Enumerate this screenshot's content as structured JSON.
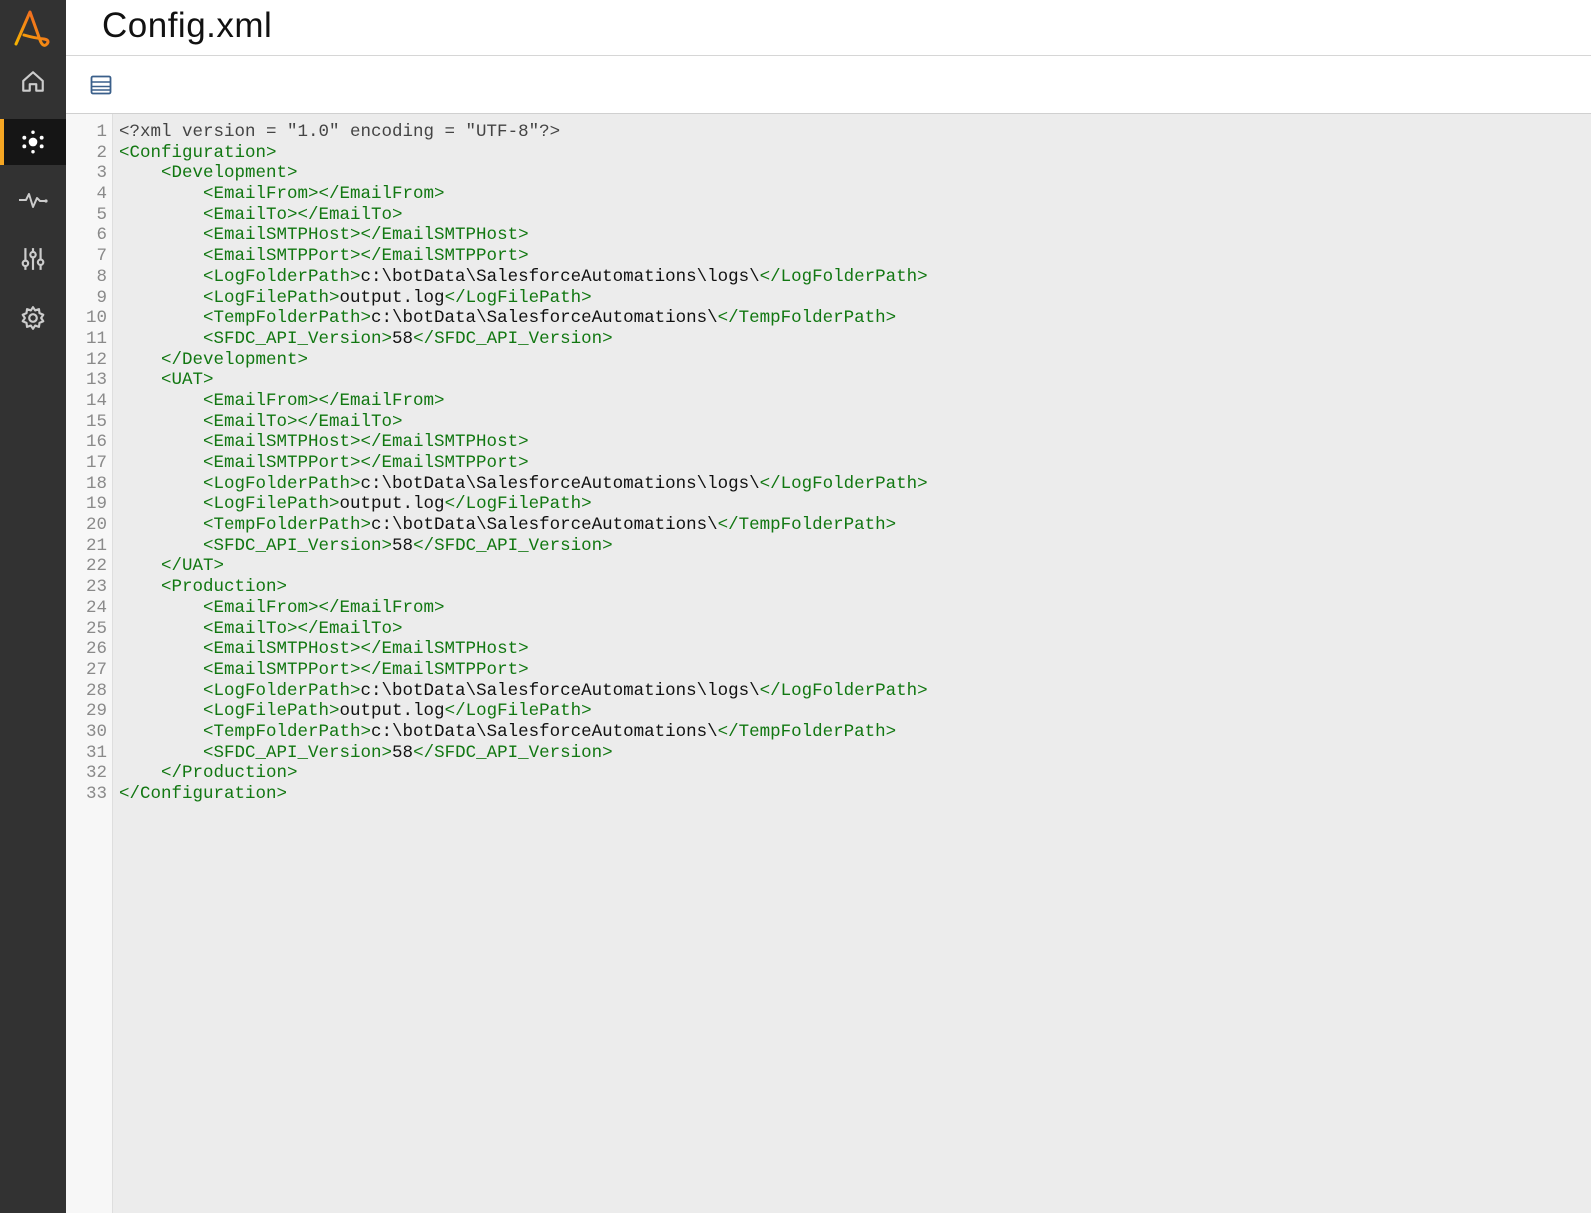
{
  "header": {
    "title": "Config.xml"
  },
  "sidebar": {
    "items": [
      {
        "name": "home",
        "icon": "home-icon"
      },
      {
        "name": "bots",
        "icon": "bot-cluster-icon",
        "active": true
      },
      {
        "name": "activity",
        "icon": "pulse-icon"
      },
      {
        "name": "controls",
        "icon": "sliders-icon"
      },
      {
        "name": "settings",
        "icon": "gear-icon"
      }
    ]
  },
  "colors": {
    "accent": "#f5a623",
    "tag": "#117711",
    "sidebar": "#323232"
  },
  "editor": {
    "lines": [
      [
        [
          "decl",
          "<?xml version = \"1.0\" encoding = \"UTF-8\"?>"
        ]
      ],
      [
        [
          "tag",
          "<Configuration>"
        ]
      ],
      [
        [
          "txt",
          "    "
        ],
        [
          "tag",
          "<Development>"
        ]
      ],
      [
        [
          "txt",
          "        "
        ],
        [
          "tag",
          "<EmailFrom></EmailFrom>"
        ]
      ],
      [
        [
          "txt",
          "        "
        ],
        [
          "tag",
          "<EmailTo></EmailTo>"
        ]
      ],
      [
        [
          "txt",
          "        "
        ],
        [
          "tag",
          "<EmailSMTPHost></EmailSMTPHost>"
        ]
      ],
      [
        [
          "txt",
          "        "
        ],
        [
          "tag",
          "<EmailSMTPPort></EmailSMTPPort>"
        ]
      ],
      [
        [
          "txt",
          "        "
        ],
        [
          "tag",
          "<LogFolderPath>"
        ],
        [
          "txt",
          "c:\\botData\\SalesforceAutomations\\logs\\"
        ],
        [
          "tag",
          "</LogFolderPath>"
        ]
      ],
      [
        [
          "txt",
          "        "
        ],
        [
          "tag",
          "<LogFilePath>"
        ],
        [
          "txt",
          "output.log"
        ],
        [
          "tag",
          "</LogFilePath>"
        ]
      ],
      [
        [
          "txt",
          "        "
        ],
        [
          "tag",
          "<TempFolderPath>"
        ],
        [
          "txt",
          "c:\\botData\\SalesforceAutomations\\"
        ],
        [
          "tag",
          "</TempFolderPath>"
        ]
      ],
      [
        [
          "txt",
          "        "
        ],
        [
          "tag",
          "<SFDC_API_Version>"
        ],
        [
          "txt",
          "58"
        ],
        [
          "tag",
          "</SFDC_API_Version>"
        ]
      ],
      [
        [
          "txt",
          "    "
        ],
        [
          "tag",
          "</Development>"
        ]
      ],
      [
        [
          "txt",
          "    "
        ],
        [
          "tag",
          "<UAT>"
        ]
      ],
      [
        [
          "txt",
          "        "
        ],
        [
          "tag",
          "<EmailFrom></EmailFrom>"
        ]
      ],
      [
        [
          "txt",
          "        "
        ],
        [
          "tag",
          "<EmailTo></EmailTo>"
        ]
      ],
      [
        [
          "txt",
          "        "
        ],
        [
          "tag",
          "<EmailSMTPHost></EmailSMTPHost>"
        ]
      ],
      [
        [
          "txt",
          "        "
        ],
        [
          "tag",
          "<EmailSMTPPort></EmailSMTPPort>"
        ]
      ],
      [
        [
          "txt",
          "        "
        ],
        [
          "tag",
          "<LogFolderPath>"
        ],
        [
          "txt",
          "c:\\botData\\SalesforceAutomations\\logs\\"
        ],
        [
          "tag",
          "</LogFolderPath>"
        ]
      ],
      [
        [
          "txt",
          "        "
        ],
        [
          "tag",
          "<LogFilePath>"
        ],
        [
          "txt",
          "output.log"
        ],
        [
          "tag",
          "</LogFilePath>"
        ]
      ],
      [
        [
          "txt",
          "        "
        ],
        [
          "tag",
          "<TempFolderPath>"
        ],
        [
          "txt",
          "c:\\botData\\SalesforceAutomations\\"
        ],
        [
          "tag",
          "</TempFolderPath>"
        ]
      ],
      [
        [
          "txt",
          "        "
        ],
        [
          "tag",
          "<SFDC_API_Version>"
        ],
        [
          "txt",
          "58"
        ],
        [
          "tag",
          "</SFDC_API_Version>"
        ]
      ],
      [
        [
          "txt",
          "    "
        ],
        [
          "tag",
          "</UAT>"
        ]
      ],
      [
        [
          "txt",
          "    "
        ],
        [
          "tag",
          "<Production>"
        ]
      ],
      [
        [
          "txt",
          "        "
        ],
        [
          "tag",
          "<EmailFrom></EmailFrom>"
        ]
      ],
      [
        [
          "txt",
          "        "
        ],
        [
          "tag",
          "<EmailTo></EmailTo>"
        ]
      ],
      [
        [
          "txt",
          "        "
        ],
        [
          "tag",
          "<EmailSMTPHost></EmailSMTPHost>"
        ]
      ],
      [
        [
          "txt",
          "        "
        ],
        [
          "tag",
          "<EmailSMTPPort></EmailSMTPPort>"
        ]
      ],
      [
        [
          "txt",
          "        "
        ],
        [
          "tag",
          "<LogFolderPath>"
        ],
        [
          "txt",
          "c:\\botData\\SalesforceAutomations\\logs\\"
        ],
        [
          "tag",
          "</LogFolderPath>"
        ]
      ],
      [
        [
          "txt",
          "        "
        ],
        [
          "tag",
          "<LogFilePath>"
        ],
        [
          "txt",
          "output.log"
        ],
        [
          "tag",
          "</LogFilePath>"
        ]
      ],
      [
        [
          "txt",
          "        "
        ],
        [
          "tag",
          "<TempFolderPath>"
        ],
        [
          "txt",
          "c:\\botData\\SalesforceAutomations\\"
        ],
        [
          "tag",
          "</TempFolderPath>"
        ]
      ],
      [
        [
          "txt",
          "        "
        ],
        [
          "tag",
          "<SFDC_API_Version>"
        ],
        [
          "txt",
          "58"
        ],
        [
          "tag",
          "</SFDC_API_Version>"
        ]
      ],
      [
        [
          "txt",
          "    "
        ],
        [
          "tag",
          "</Production>"
        ]
      ],
      [
        [
          "tag",
          "</Configuration>"
        ]
      ]
    ]
  }
}
